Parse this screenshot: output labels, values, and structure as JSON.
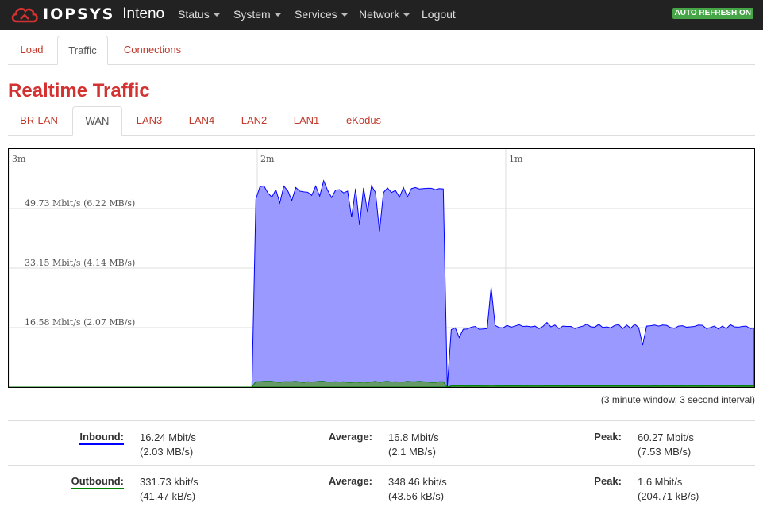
{
  "brand": {
    "name": "IOPSYS",
    "product": "Inteno"
  },
  "nav": [
    {
      "label": "Status",
      "dropdown": true
    },
    {
      "label": "System",
      "dropdown": true
    },
    {
      "label": "Services",
      "dropdown": true
    },
    {
      "label": "Network",
      "dropdown": true
    },
    {
      "label": "Logout",
      "dropdown": false
    }
  ],
  "auto_refresh": "AUTO REFRESH ON",
  "top_tabs": [
    {
      "label": "Load",
      "active": false
    },
    {
      "label": "Traffic",
      "active": true
    },
    {
      "label": "Connections",
      "active": false
    }
  ],
  "page_title": "Realtime Traffic",
  "iface_tabs": [
    {
      "label": "BR-LAN",
      "active": false
    },
    {
      "label": "WAN",
      "active": true
    },
    {
      "label": "LAN3",
      "active": false
    },
    {
      "label": "LAN4",
      "active": false
    },
    {
      "label": "LAN2",
      "active": false
    },
    {
      "label": "LAN1",
      "active": false
    },
    {
      "label": "eKodus",
      "active": false
    }
  ],
  "colors": {
    "inbound": "#0000ff",
    "inbound_fill": "#9999ff",
    "outbound": "#008000",
    "outbound_fill": "#669966",
    "accent": "#d43131",
    "auto_refresh": "#46a546"
  },
  "chart_data": {
    "type": "area",
    "x_ticks": [
      "3m",
      "2m",
      "1m"
    ],
    "y_ticks": [
      {
        "value": 16.58,
        "label": "16.58 Mbit/s (2.07 MB/s)"
      },
      {
        "value": 33.15,
        "label": "33.15 Mbit/s (4.14 MB/s)"
      },
      {
        "value": 49.73,
        "label": "49.73 Mbit/s (6.22 MB/s)"
      }
    ],
    "ylim": [
      0,
      66.3
    ],
    "xlim": [
      0,
      180
    ],
    "series": [
      {
        "name": "Inbound",
        "values": [
          0,
          0,
          0,
          0,
          0,
          0,
          0,
          0,
          0,
          0,
          0,
          0,
          0,
          0,
          0,
          0,
          0,
          0,
          0,
          0,
          0,
          0,
          0,
          0,
          0,
          0,
          0,
          0,
          0,
          0,
          0,
          0,
          0,
          0,
          0,
          0,
          0,
          0,
          0,
          0,
          0,
          0,
          0,
          0,
          0,
          0,
          0,
          0,
          0,
          0,
          0,
          0,
          0,
          0,
          0,
          0,
          0,
          0,
          0,
          0,
          0,
          0,
          52.4,
          55.8,
          56.1,
          54.1,
          52.9,
          55.0,
          51.3,
          56.0,
          54.7,
          52.0,
          55.6,
          54.6,
          54.4,
          54.3,
          53.4,
          56.0,
          53.2,
          57.5,
          54.8,
          52.8,
          54.9,
          55.0,
          54.1,
          54.6,
          47.3,
          55.3,
          45.1,
          55.5,
          48.8,
          56.1,
          54.2,
          43.4,
          54.2,
          55.5,
          54.2,
          54.8,
          52.9,
          55.6,
          53.0,
          55.3,
          55.6,
          55.2,
          55.3,
          55.4,
          55.4,
          55.0,
          55.3,
          55.2,
          0,
          16.0,
          16.5,
          13.8,
          16.1,
          16.2,
          16.7,
          16.9,
          16.1,
          16.2,
          16.3,
          27.8,
          17.2,
          16.6,
          16.5,
          17.2,
          16.7,
          17.0,
          17.4,
          16.9,
          17.0,
          16.8,
          17.0,
          16.3,
          16.9,
          18.0,
          16.8,
          17.3,
          16.3,
          17.0,
          16.9,
          16.9,
          16.3,
          16.7,
          17.0,
          17.5,
          16.8,
          16.7,
          17.5,
          16.6,
          16.8,
          16.5,
          17.2,
          17.4,
          16.3,
          17.3,
          16.4,
          17.5,
          16.6,
          11.7,
          17.0,
          17.1,
          17.3,
          17.0,
          17.3,
          17.2,
          16.6,
          16.4,
          17.0,
          17.1,
          16.7,
          16.8,
          16.9,
          17.3,
          17.2,
          16.3,
          16.6,
          17.0,
          16.2,
          17.0,
          16.3,
          17.4,
          16.8,
          16.7,
          16.9,
          17.0,
          16.3,
          16.5
        ]
      },
      {
        "name": "Outbound",
        "values": [
          0,
          0,
          0,
          0,
          0,
          0,
          0,
          0,
          0,
          0,
          0,
          0,
          0,
          0,
          0,
          0,
          0,
          0,
          0,
          0,
          0,
          0,
          0,
          0,
          0,
          0,
          0,
          0,
          0,
          0,
          0,
          0,
          0,
          0,
          0,
          0,
          0,
          0,
          0,
          0,
          0,
          0,
          0,
          0,
          0,
          0,
          0,
          0,
          0,
          0,
          0,
          0,
          0,
          0,
          0,
          0,
          0,
          0,
          0,
          0,
          0,
          0,
          1.5,
          1.5,
          1.6,
          1.6,
          1.6,
          1.4,
          1.3,
          1.5,
          1.5,
          1.5,
          1.6,
          1.4,
          1.3,
          1.5,
          1.4,
          1.5,
          1.6,
          1.6,
          1.4,
          1.4,
          1.5,
          1.4,
          1.5,
          1.3,
          1.3,
          1.4,
          1.3,
          1.4,
          1.3,
          1.4,
          1.6,
          1.3,
          1.5,
          1.6,
          1.4,
          1.5,
          1.4,
          1.4,
          1.6,
          1.5,
          1.5,
          1.6,
          1.5,
          1.4,
          1.3,
          1.3,
          1.5,
          1.5,
          0,
          0.34,
          0.33,
          0.34,
          0.34,
          0.31,
          0.35,
          0.32,
          0.32,
          0.3,
          0.34,
          0.43,
          0.35,
          0.33,
          0.31,
          0.34,
          0.34,
          0.34,
          0.35,
          0.31,
          0.33,
          0.35,
          0.35,
          0.35,
          0.3,
          0.35,
          0.32,
          0.33,
          0.34,
          0.3,
          0.33,
          0.32,
          0.32,
          0.33,
          0.33,
          0.34,
          0.33,
          0.33,
          0.33,
          0.32,
          0.34,
          0.35,
          0.32,
          0.32,
          0.34,
          0.32,
          0.32,
          0.32,
          0.34,
          0.3,
          0.31,
          0.31,
          0.35,
          0.31,
          0.32,
          0.32,
          0.32,
          0.35,
          0.31,
          0.35,
          0.3,
          0.32,
          0.35,
          0.31,
          0.35,
          0.34,
          0.33,
          0.35,
          0.35,
          0.31,
          0.34,
          0.34,
          0.33,
          0.31,
          0.35,
          0.31,
          0.33,
          0.33
        ]
      }
    ]
  },
  "window_note": "(3 minute window, 3 second interval)",
  "stats": {
    "inbound": {
      "label": "Inbound:",
      "cur": "16.24 Mbit/s",
      "cur_b": "(2.03 MB/s)",
      "avg_label": "Average:",
      "avg": "16.8 Mbit/s",
      "avg_b": "(2.1 MB/s)",
      "peak_label": "Peak:",
      "peak": "60.27 Mbit/s",
      "peak_b": "(7.53 MB/s)"
    },
    "outbound": {
      "label": "Outbound:",
      "cur": "331.73 kbit/s",
      "cur_b": "(41.47 kB/s)",
      "avg_label": "Average:",
      "avg": "348.46 kbit/s",
      "avg_b": "(43.56 kB/s)",
      "peak_label": "Peak:",
      "peak": "1.6 Mbit/s",
      "peak_b": "(204.71 kB/s)"
    }
  }
}
